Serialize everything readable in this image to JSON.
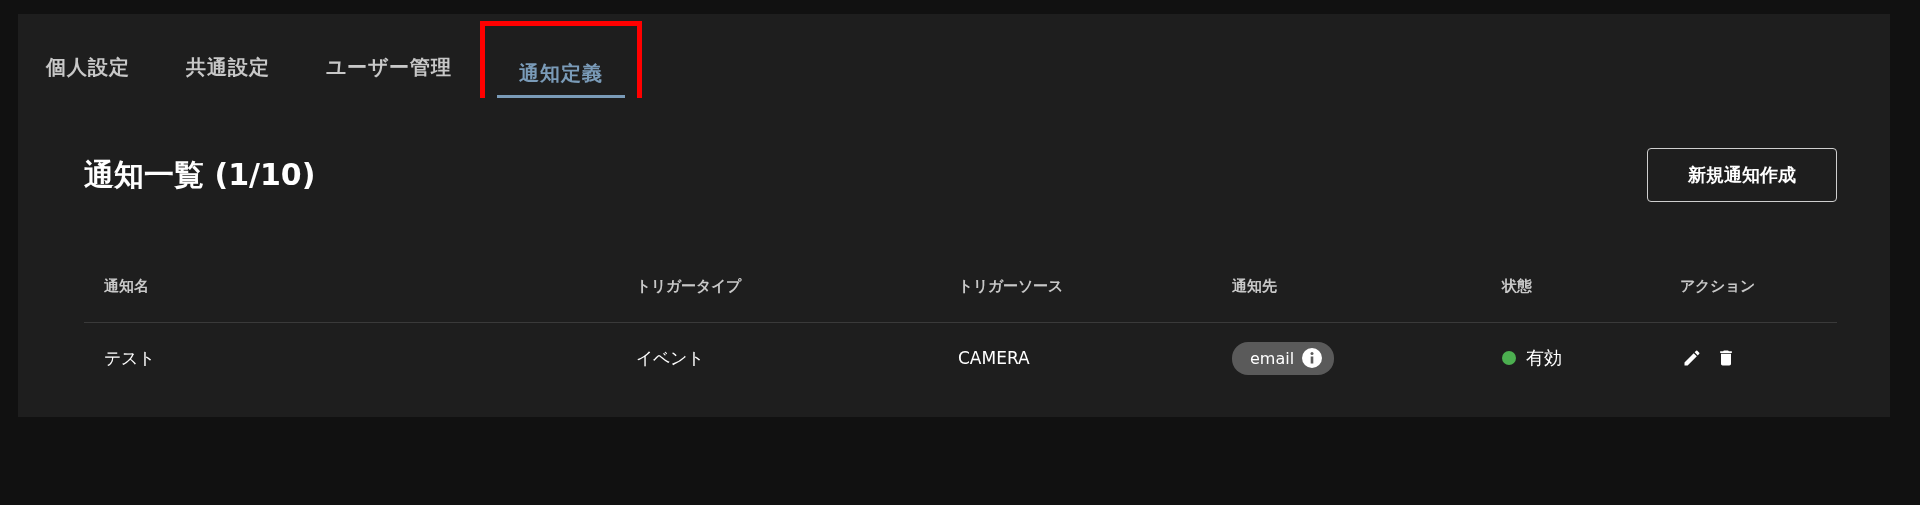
{
  "tabs": [
    {
      "label": "個人設定",
      "selected": false,
      "highlighted": false
    },
    {
      "label": "共通設定",
      "selected": false,
      "highlighted": false
    },
    {
      "label": "ユーザー管理",
      "selected": false,
      "highlighted": false
    },
    {
      "label": "通知定義",
      "selected": true,
      "highlighted": true
    }
  ],
  "heading": "通知一覧 (1/10)",
  "create_button": "新規通知作成",
  "table": {
    "columns": [
      "通知名",
      "トリガータイプ",
      "トリガーソース",
      "通知先",
      "状態",
      "アクション"
    ],
    "rows": [
      {
        "name": "テスト",
        "trigger_type": "イベント",
        "trigger_source": "CAMERA",
        "destination": "email",
        "status": {
          "label": "有効",
          "color": "#4caf50"
        }
      }
    ]
  }
}
